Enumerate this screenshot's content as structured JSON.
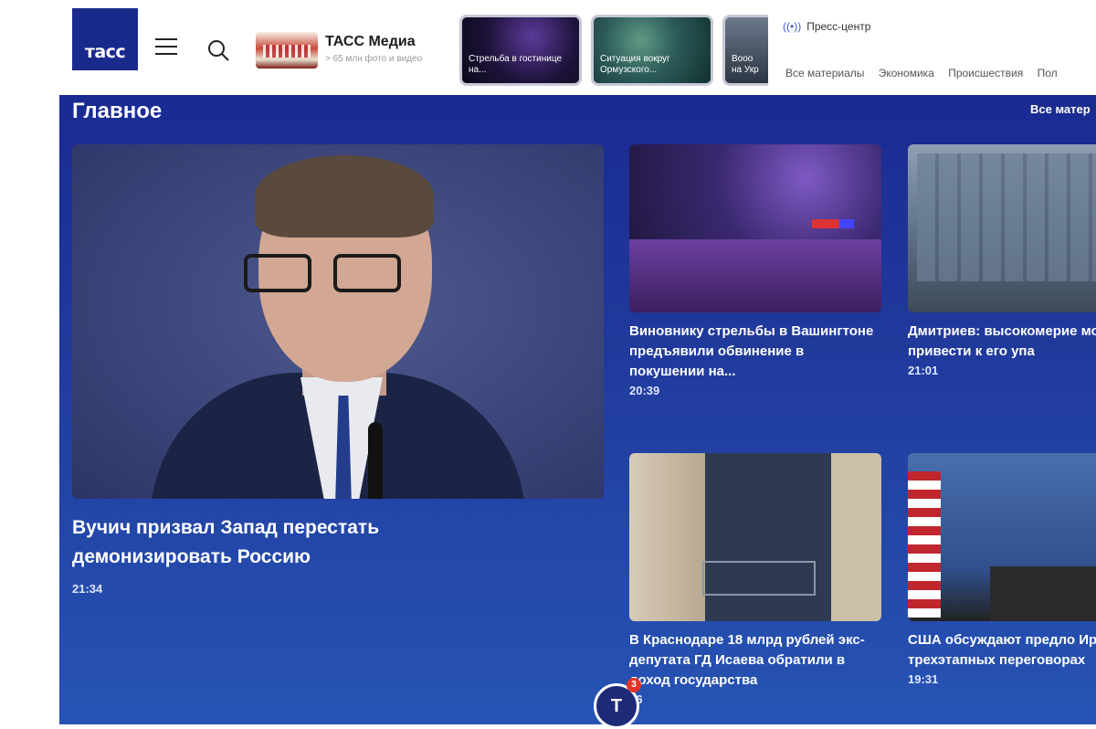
{
  "header": {
    "logo_text": "тасс",
    "media": {
      "title": "ТАСС Медиа",
      "subtitle": "> 65 млн фото и видео"
    },
    "stories": [
      {
        "caption": "Стрельба в гостинице на..."
      },
      {
        "caption": "Ситуация вокруг Ормузского..."
      },
      {
        "caption": "Вооо на Укр"
      }
    ],
    "press_center": "Пресс-центр",
    "nav": [
      "Все материалы",
      "Экономика",
      "Происшествия",
      "Пол"
    ]
  },
  "main": {
    "section_title": "Главное",
    "all_link": "Все матер",
    "featured": {
      "title": "Вучич призвал Запад перестать демонизировать Россию",
      "time": "21:34"
    },
    "cards": [
      {
        "title": "Виновнику стрельбы в Вашингтоне предъявили обвинение в покушении на...",
        "time": "20:39"
      },
      {
        "title": "Дмитриев: высокомерие может привести к его упа",
        "time": "21:01"
      },
      {
        "title": "В Краснодаре 18 млрд рублей экс-депутата ГД Исаева обратили в доход государства",
        "time": "16"
      },
      {
        "title": "США обсуждают предло Ирана о трехэтапных переговорах",
        "time": "19:31"
      }
    ]
  },
  "fab": {
    "label": "Т",
    "badge": "3"
  },
  "colors": {
    "brand": "#1a2a8c",
    "panel": "#203a9c",
    "badge": "#e2332b"
  }
}
